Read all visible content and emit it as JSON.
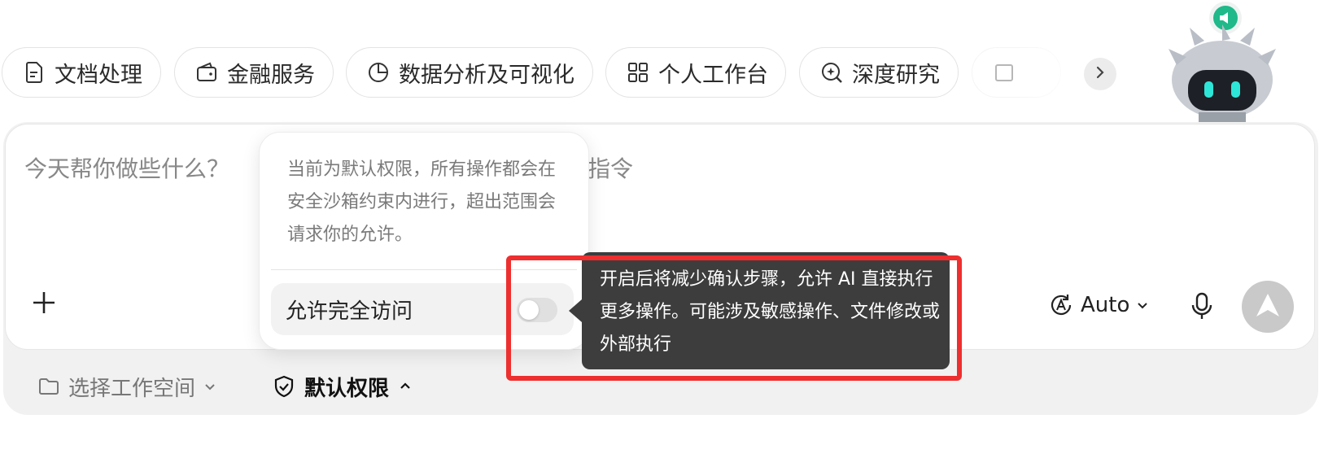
{
  "chips": [
    {
      "label": "文档处理",
      "icon": "document-icon"
    },
    {
      "label": "金融服务",
      "icon": "wallet-icon"
    },
    {
      "label": "数据分析及可视化",
      "icon": "pie-chart-icon"
    },
    {
      "label": "个人工作台",
      "icon": "grid-icon"
    },
    {
      "label": "深度研究",
      "icon": "search-research-icon"
    }
  ],
  "input": {
    "placeholder_start": "今天帮你做些什么？",
    "placeholder_end": "指令"
  },
  "toolbar": {
    "model_label": "Auto"
  },
  "footer": {
    "workspace_label": "选择工作空间",
    "permission_label": "默认权限"
  },
  "permission_popover": {
    "description": "当前为默认权限，所有操作都会在安全沙箱约束内进行，超出范围会请求你的允许。",
    "toggle_label": "允许完全访问",
    "toggle_on": false
  },
  "tooltip": {
    "text": "开启后将减少确认步骤，允许 AI 直接执行更多操作。可能涉及敏感操作、文件修改或外部执行"
  },
  "colors": {
    "highlight": "#ee2f2f",
    "tooltip_bg": "#3d3d3d",
    "badge": "#1fb98a"
  }
}
